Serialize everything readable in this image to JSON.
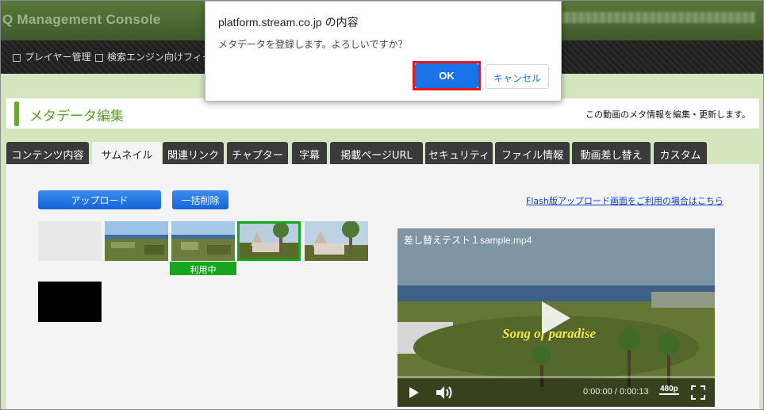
{
  "app": {
    "logo_text": "Q Management Console"
  },
  "menu": [
    {
      "label": "プレイヤー管理"
    },
    {
      "label": "検索エンジン向けフィード"
    }
  ],
  "page": {
    "title": "メタデータ編集",
    "description": "この動画のメタ情報を編集・更新します。"
  },
  "tabs": [
    {
      "label": "コンテンツ内容",
      "active": false
    },
    {
      "label": "サムネイル",
      "active": true
    },
    {
      "label": "関連リンク",
      "active": false
    },
    {
      "label": "チャプター",
      "active": false
    },
    {
      "label": "字幕",
      "active": false
    },
    {
      "label": "掲載ページURL",
      "active": false
    },
    {
      "label": "セキュリティ",
      "active": false
    },
    {
      "label": "ファイル情報",
      "active": false
    },
    {
      "label": "動画差し替え",
      "active": false
    },
    {
      "label": "カスタム",
      "active": false
    }
  ],
  "thumbnail_panel": {
    "upload_button": "アップロード",
    "bulk_delete_button": "一括削除",
    "flash_link": "Flash版アップロード画面をご利用の場合はこちら",
    "in_use_label": "利用中"
  },
  "player": {
    "title": "差し替えテスト１sample.mp4",
    "overlay_text": "Song of paradise",
    "time": "0:00:00 / 0:00:13",
    "quality": "480p"
  },
  "dialog": {
    "title": "platform.stream.co.jp の内容",
    "message": "メタデータを登録します。よろしいですか？",
    "ok_label": "OK",
    "cancel_label": "キャンセル"
  },
  "colors": {
    "accent_green": "#5aa121",
    "selected_border": "#16a51f",
    "primary_blue": "#1a73e8",
    "highlight_red": "#e5161c"
  }
}
